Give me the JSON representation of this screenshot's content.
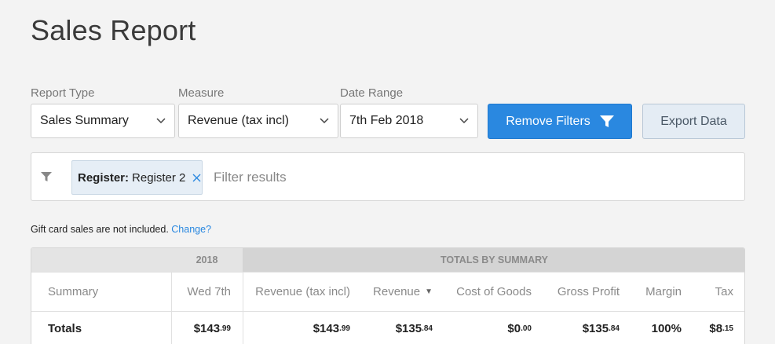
{
  "page": {
    "title": "Sales Report"
  },
  "filters": {
    "report_type": {
      "label": "Report Type",
      "value": "Sales Summary"
    },
    "measure": {
      "label": "Measure",
      "value": "Revenue (tax incl)"
    },
    "date_range": {
      "label": "Date Range",
      "value": "7th Feb 2018"
    },
    "remove_filters_label": "Remove Filters",
    "export_label": "Export Data"
  },
  "filter_bar": {
    "chip_key": "Register:",
    "chip_value": "Register 2",
    "placeholder": "Filter results"
  },
  "note": {
    "text": "Gift card sales are not included.",
    "link": "Change?"
  },
  "table": {
    "group_year": "2018",
    "group_totals": "TOTALS BY SUMMARY",
    "headers": {
      "summary": "Summary",
      "date": "Wed 7th",
      "revenue_tax_incl": "Revenue (tax incl)",
      "revenue": "Revenue",
      "revenue_sort": "▼",
      "cost_of_goods": "Cost of Goods",
      "gross_profit": "Gross Profit",
      "margin": "Margin",
      "tax": "Tax"
    },
    "totals_row": {
      "label": "Totals",
      "date": {
        "main": "$143",
        "cents": ".99"
      },
      "revenue_tax_incl": {
        "main": "$143",
        "cents": ".99"
      },
      "revenue": {
        "main": "$135",
        "cents": ".84"
      },
      "cost_of_goods": {
        "main": "$0",
        "cents": ".00"
      },
      "gross_profit": {
        "main": "$135",
        "cents": ".84"
      },
      "margin": "100%",
      "tax": {
        "main": "$8",
        "cents": ".15"
      }
    }
  },
  "colors": {
    "primary": "#2a88e0",
    "background": "#f3f3f3",
    "secondary_button": "#e4ecf4"
  }
}
